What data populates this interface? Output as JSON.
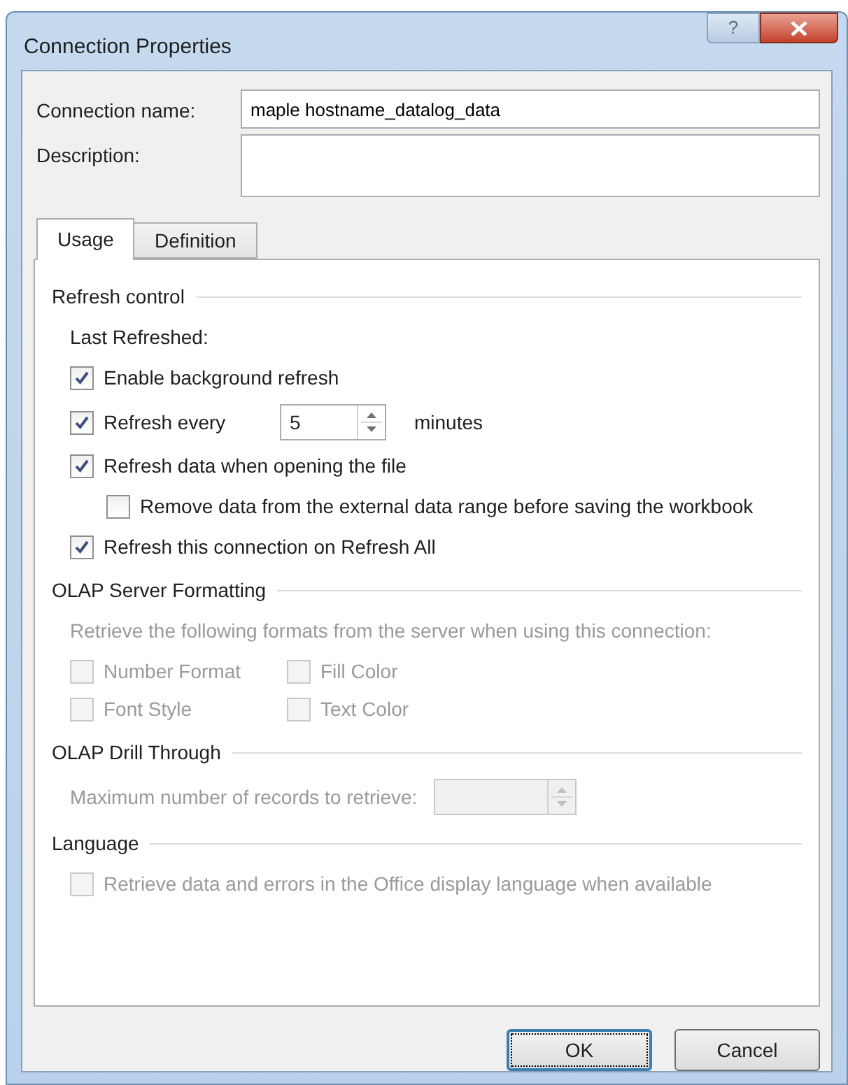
{
  "window": {
    "title": "Connection Properties",
    "help_button": "?"
  },
  "fields": [
    {
      "label": "Connection name:",
      "value": "maple hostname_datalog_data",
      "kind": "line"
    },
    {
      "label": "Description:",
      "kind": "area"
    }
  ],
  "tabs": [
    {
      "label": "Usage",
      "selected": true
    },
    {
      "label": "Definition",
      "selected": false
    }
  ],
  "sections": [
    {
      "title": "Refresh control",
      "items": [
        {
          "kind": "text",
          "text": "Last Refreshed:",
          "disabled": false
        },
        {
          "kind": "checkbox",
          "label": "Enable background refresh",
          "checked": true,
          "disabled": false
        },
        {
          "kind": "checkbox_spin",
          "label": "Refresh every",
          "checked": true,
          "disabled": false,
          "value": "5",
          "suffix": "minutes"
        },
        {
          "kind": "checkbox",
          "label": "Refresh data when opening the file",
          "checked": true,
          "disabled": false,
          "children": [
            {
              "kind": "checkbox",
              "label": "Remove data from the external data range before saving the workbook",
              "checked": false,
              "disabled": false
            }
          ]
        },
        {
          "kind": "checkbox",
          "label": "Refresh this connection on Refresh All",
          "checked": true,
          "disabled": false
        }
      ]
    },
    {
      "title": "OLAP Server Formatting",
      "items": [
        {
          "kind": "text",
          "text": "Retrieve the following formats from the server when using this connection:",
          "disabled": true
        },
        {
          "kind": "checkbox_grid",
          "options": [
            {
              "label": "Number Format",
              "checked": false,
              "disabled": true
            },
            {
              "label": "Fill Color",
              "checked": false,
              "disabled": true
            },
            {
              "label": "Font Style",
              "checked": false,
              "disabled": true
            },
            {
              "label": "Text Color",
              "checked": false,
              "disabled": true
            }
          ]
        }
      ]
    },
    {
      "title": "OLAP Drill Through",
      "items": [
        {
          "kind": "spin_field",
          "label": "Maximum number of records to retrieve:",
          "value": "",
          "disabled": true
        }
      ]
    },
    {
      "title": "Language",
      "items": [
        {
          "kind": "checkbox",
          "label": "Retrieve data and errors in the Office display language when available",
          "checked": false,
          "disabled": true
        }
      ]
    }
  ],
  "buttons": [
    {
      "label": "OK",
      "default": true
    },
    {
      "label": "Cancel",
      "default": false
    }
  ]
}
